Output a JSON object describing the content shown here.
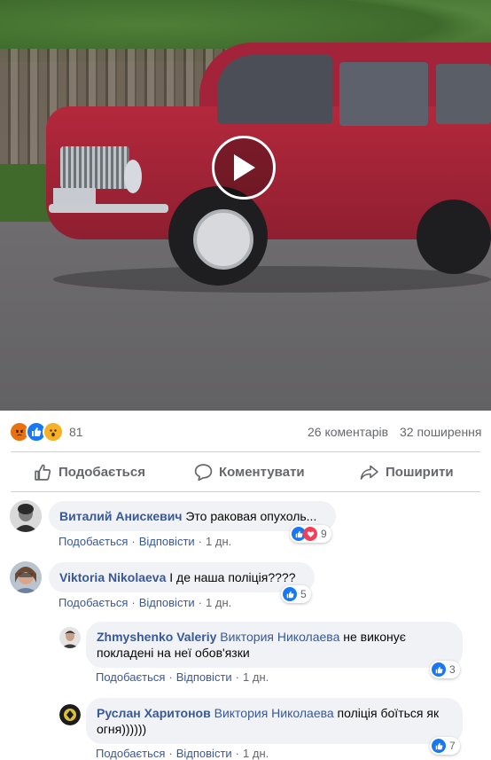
{
  "post": {
    "reactions_count": "81",
    "comments_count": "26 коментарів",
    "shares_count": "32 поширення",
    "colors": {
      "like": "#1877f2",
      "love": "#f33e58",
      "angry": "#e9710f",
      "wow": "#f7b125"
    },
    "icons": [
      "angry-reaction-icon",
      "like-reaction-icon",
      "wow-reaction-icon"
    ]
  },
  "actions": {
    "like": "Подобається",
    "comment": "Коментувати",
    "share": "Поширити"
  },
  "comments": [
    {
      "author": "Виталий Анискевич",
      "text": " Это раковая опухоль...",
      "like": "Подобається",
      "reply": "Відповісти",
      "time": "1 дн.",
      "reaction_count": "9",
      "reactions": [
        "like",
        "love"
      ]
    },
    {
      "author": "Viktoria Nikolaeva",
      "text": " І де наша поліція????",
      "like": "Подобається",
      "reply": "Відповісти",
      "time": "1 дн.",
      "reaction_count": "5",
      "reactions": [
        "like"
      ]
    },
    {
      "author": "Zhmyshenko Valeriy",
      "mention": "Виктория Николаева",
      "text": " не виконує покладені на неї обов'язки",
      "like": "Подобається",
      "reply": "Відповісти",
      "time": "1 дн.",
      "reaction_count": "3",
      "reactions": [
        "like"
      ]
    },
    {
      "author": "Руслан Харитонов",
      "mention": "Виктория Николаева",
      "text": " поліція боїться як огня))))))",
      "like": "Подобається",
      "reply": "Відповісти",
      "time": "1 дн.",
      "reaction_count": "7",
      "reactions": [
        "like"
      ]
    }
  ]
}
